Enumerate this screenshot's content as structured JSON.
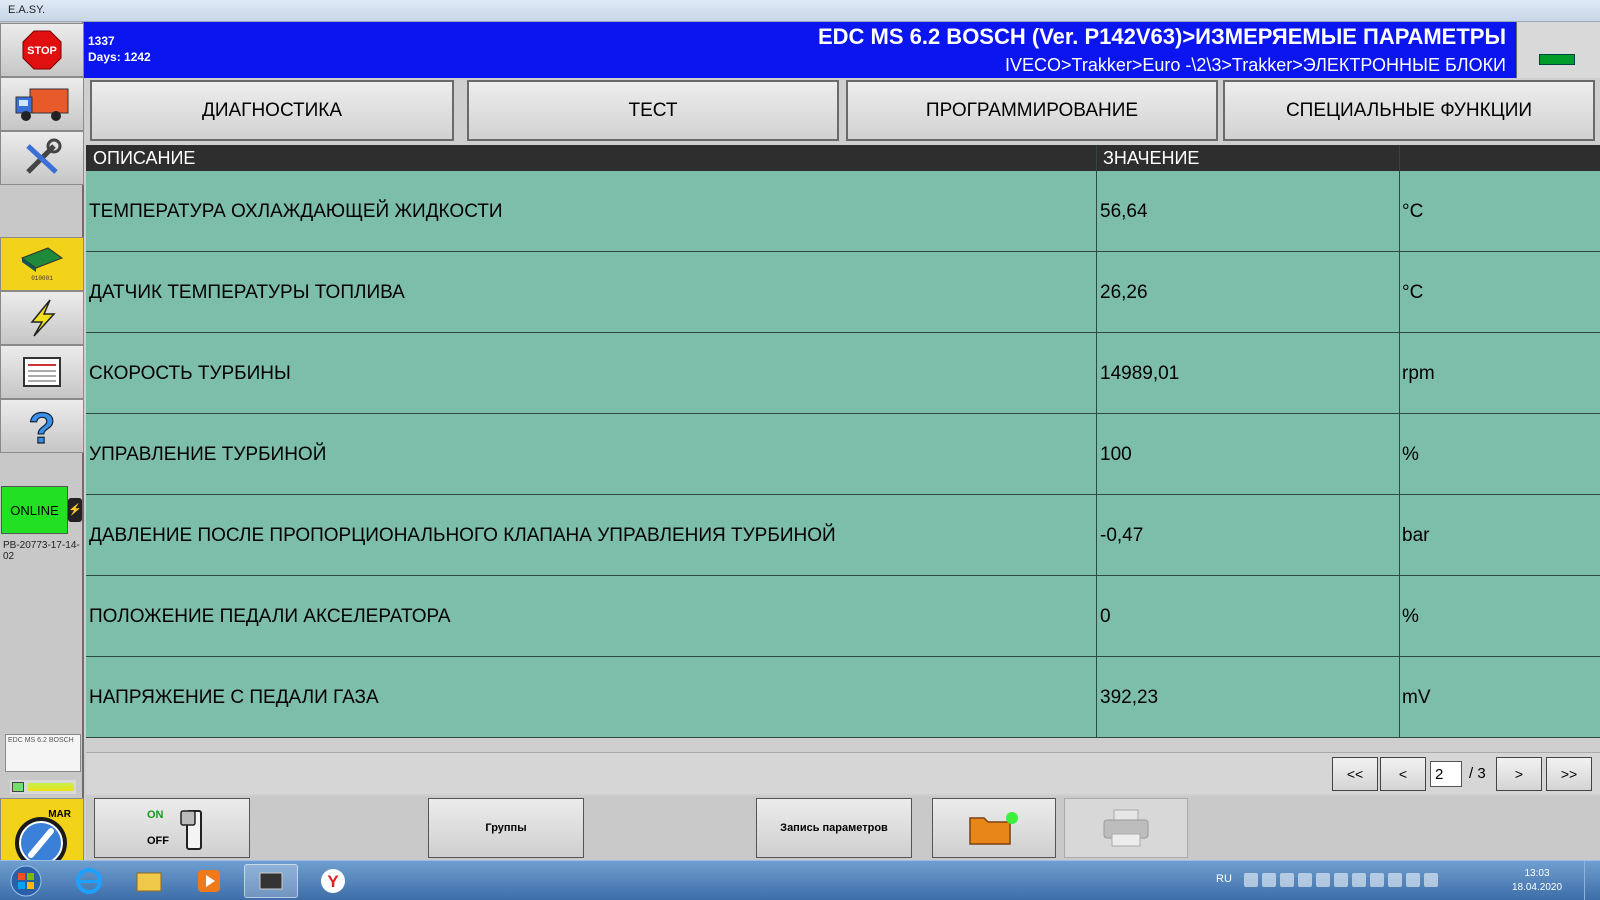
{
  "window": {
    "title": "E.A.SY."
  },
  "sidebar": {
    "buttons": [
      {
        "icon": "stop-icon",
        "label": "STOP"
      },
      {
        "icon": "truck-icon"
      },
      {
        "icon": "tools-icon"
      },
      {
        "icon": "ecu-board-icon"
      },
      {
        "icon": "lightning-icon"
      },
      {
        "icon": "report-icon"
      },
      {
        "icon": "help-icon"
      }
    ],
    "online": "ONLINE",
    "serial": "PB-20773-17-14-02",
    "ecu_thumb": "EDC MS 6.2 BOSCH",
    "key_label": "MAR"
  },
  "header": {
    "counter": "1337",
    "days": "Days: 1242",
    "title": "EDC MS 6.2 BOSCH (Ver. P142V63)>ИЗМЕРЯЕМЫЕ ПАРАМЕТРЫ",
    "path": "IVECO>Trakker>Euro -\\2\\3>Trakker>ЭЛЕКТРОННЫЕ БЛОКИ",
    "status_color": "#009c2a"
  },
  "tabs": [
    {
      "label": "ДИАГНОСТИКА"
    },
    {
      "label": "ТЕСТ"
    },
    {
      "label": "ПРОГРАММИРОВАНИЕ"
    },
    {
      "label": "СПЕЦИАЛЬНЫЕ ФУНКЦИИ"
    }
  ],
  "table": {
    "columns": [
      "ОПИСАНИЕ",
      "ЗНАЧЕНИЕ",
      ""
    ],
    "rows": [
      {
        "description": "ТЕМПЕРАТУРА ОХЛАЖДАЮЩЕЙ ЖИДКОСТИ",
        "value": "56,64",
        "unit": "°C"
      },
      {
        "description": "ДАТЧИК ТЕМПЕРАТУРЫ ТОПЛИВА",
        "value": "26,26",
        "unit": "°C"
      },
      {
        "description": "СКОРОСТЬ ТУРБИНЫ",
        "value": "14989,01",
        "unit": "rpm"
      },
      {
        "description": "УПРАВЛЕНИЕ ТУРБИНОЙ",
        "value": "100",
        "unit": "%"
      },
      {
        "description": "ДАВЛЕНИЕ ПОСЛЕ ПРОПОРЦИОНАЛЬНОГО КЛАПАНА УПРАВЛЕНИЯ ТУРБИНОЙ",
        "value": "-0,47",
        "unit": "bar"
      },
      {
        "description": "ПОЛОЖЕНИЕ ПЕДАЛИ АКСЕЛЕРАТОРА",
        "value": "0",
        "unit": "%"
      },
      {
        "description": "НАПРЯЖЕНИЕ С ПЕДАЛИ ГАЗА",
        "value": "392,23",
        "unit": "mV"
      }
    ],
    "row_color": "#7dbeaa",
    "header_color": "#2e2e2e"
  },
  "pager": {
    "first": "<<",
    "prev": "<",
    "current": "2",
    "total": "/ 3",
    "next": ">",
    "last": ">>"
  },
  "actions": {
    "on": "ON",
    "off": "OFF",
    "groups": "Группы",
    "record": "Запись параметров",
    "folder_icon": "folder-icon",
    "print_icon": "printer-icon"
  },
  "taskbar": {
    "lang": "RU",
    "time": "13:03",
    "date": "18.04.2020",
    "apps": [
      "windows-start-icon",
      "internet-explorer-icon",
      "file-explorer-icon",
      "media-player-icon",
      "easy-diagnostic-icon",
      "yandex-browser-icon"
    ]
  }
}
